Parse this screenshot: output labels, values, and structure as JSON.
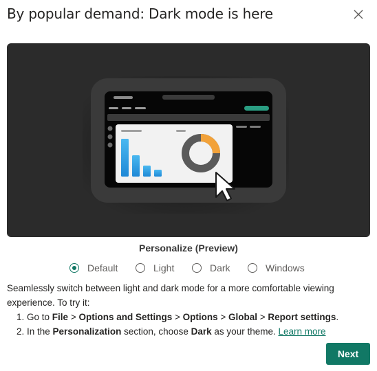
{
  "dialog": {
    "title": "By popular demand: Dark mode is here",
    "close_icon": "close-icon"
  },
  "hero": {
    "illustration": "dark-mode-report-illustration",
    "donut_accent_color": "#f2a23a",
    "bar_color": "#2aa3e8",
    "toolbar_accent_color": "#2a9d82"
  },
  "personalize": {
    "label": "Personalize (Preview)",
    "options": [
      {
        "label": "Default",
        "selected": true
      },
      {
        "label": "Light",
        "selected": false
      },
      {
        "label": "Dark",
        "selected": false
      },
      {
        "label": "Windows",
        "selected": false
      }
    ]
  },
  "description": {
    "intro": "Seamlessly switch between light and dark mode for a more comfortable viewing experience. To try it:",
    "step1": {
      "num": "1.",
      "t1": " Go to ",
      "b1": "File",
      "t2": " > ",
      "b2": "Options and Settings",
      "t3": " > ",
      "b3": "Options",
      "t4": " > ",
      "b4": "Global",
      "t5": " > ",
      "b5": "Report settings",
      "t6": "."
    },
    "step2": {
      "num": "2.",
      "t1": " In the ",
      "b1": "Personalization",
      "t2": " section, choose ",
      "b2": "Dark",
      "t3": " as your theme. ",
      "link": "Learn more"
    }
  },
  "footer": {
    "next_label": "Next",
    "accent_color": "#117865"
  }
}
